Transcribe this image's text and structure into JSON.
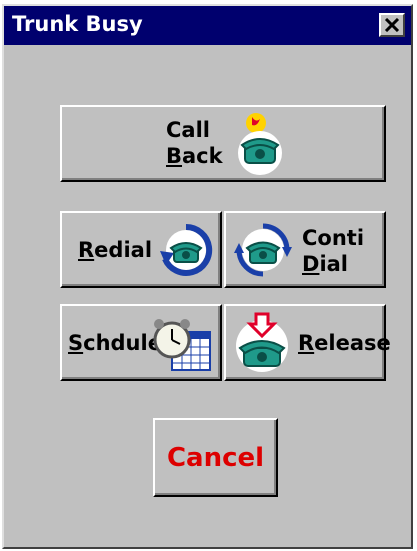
{
  "window": {
    "title": "Trunk Busy"
  },
  "buttons": {
    "call_back": {
      "line1": "Call",
      "line2": "Back"
    },
    "redial": {
      "label": "Redial"
    },
    "conti_dial": {
      "line1": "Conti",
      "line2": "Dial"
    },
    "schedule": {
      "label": "Schdule"
    },
    "release": {
      "label": "Release"
    },
    "cancel": {
      "label": "Cancel"
    }
  },
  "colors": {
    "title_bar": "#00006e",
    "dialog_face": "#c0c0c0",
    "cancel_text": "#dd0000",
    "phone_teal": "#1f9a8a",
    "arrow_blue": "#1a3fa8"
  },
  "icons": {
    "call_back": "phone-with-notification-icon",
    "redial": "phone-circular-arrow-icon",
    "conti_dial": "phone-double-arrow-icon",
    "schedule": "alarm-clock-calendar-icon",
    "release": "phone-hangup-arrow-icon",
    "close": "close-x-icon"
  }
}
